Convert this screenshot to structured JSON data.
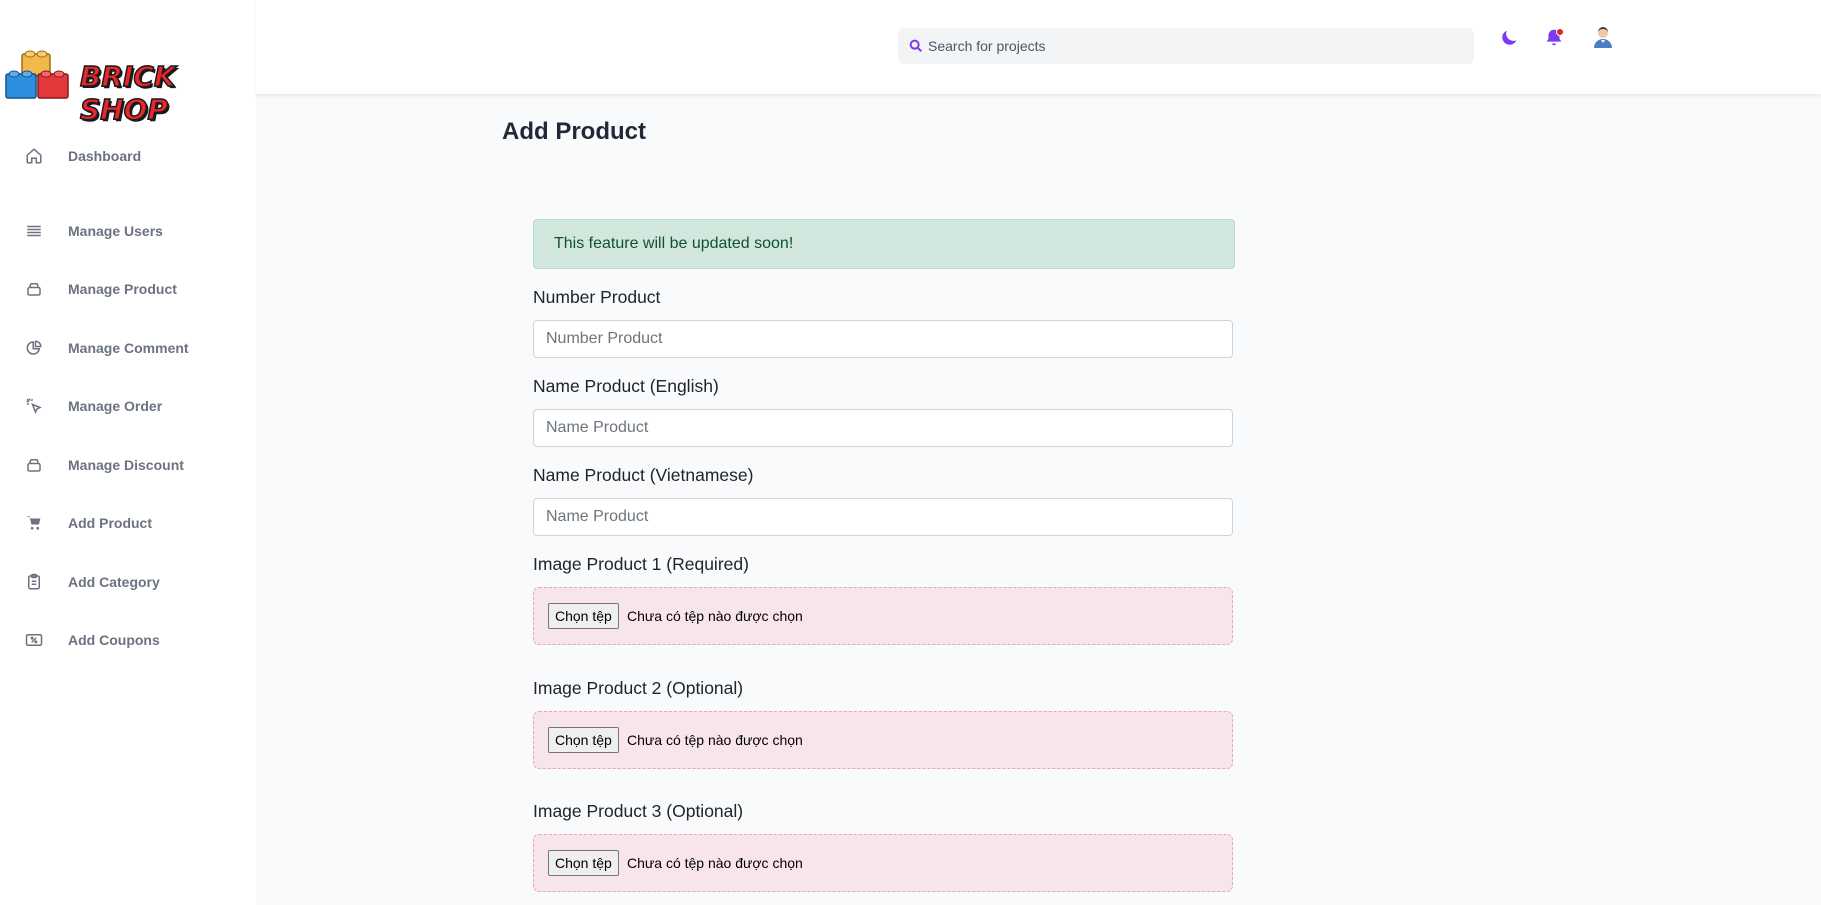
{
  "brand": {
    "name": "BRICK SHOP"
  },
  "search": {
    "placeholder": "Search for projects"
  },
  "colors": {
    "accent": "#7e3af2",
    "notification_dot": "#e02424",
    "alert_bg": "#d1e7dd",
    "alert_text": "#0f5132",
    "upload_bg": "#f8e5ea"
  },
  "sidebar": {
    "items": [
      {
        "label": "Dashboard",
        "icon": "home-icon"
      },
      {
        "label": "Manage Users",
        "icon": "list-icon"
      },
      {
        "label": "Manage Product",
        "icon": "box-icon"
      },
      {
        "label": "Manage Comment",
        "icon": "pie-chart-icon"
      },
      {
        "label": "Manage Order",
        "icon": "cursor-click-icon"
      },
      {
        "label": "Manage Discount",
        "icon": "box-icon"
      },
      {
        "label": "Add Product",
        "icon": "cart-icon"
      },
      {
        "label": "Add Category",
        "icon": "clipboard-icon"
      },
      {
        "label": "Add Coupons",
        "icon": "percent-icon"
      }
    ]
  },
  "topbar": {
    "icons": [
      "moon-icon",
      "bell-icon",
      "avatar-icon"
    ]
  },
  "page": {
    "title": "Add Product",
    "alert": "This feature will be updated soon!",
    "fields": [
      {
        "label": "Number Product",
        "placeholder": "Number Product",
        "value": ""
      },
      {
        "label": "Name Product (English)",
        "placeholder": "Name Product",
        "value": ""
      },
      {
        "label": "Name Product (Vietnamese)",
        "placeholder": "Name Product",
        "value": ""
      }
    ],
    "uploads": [
      {
        "label": "Image Product 1 (Required)",
        "button": "Chọn tệp",
        "status": "Chưa có tệp nào được chọn"
      },
      {
        "label": "Image Product 2 (Optional)",
        "button": "Chọn tệp",
        "status": "Chưa có tệp nào được chọn"
      },
      {
        "label": "Image Product 3 (Optional)",
        "button": "Chọn tệp",
        "status": "Chưa có tệp nào được chọn"
      }
    ]
  }
}
